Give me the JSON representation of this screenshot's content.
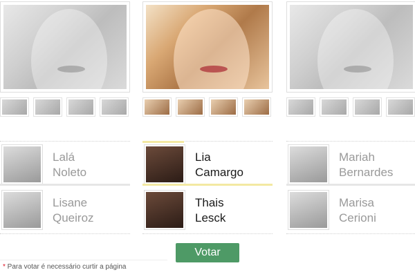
{
  "columns": [
    {
      "candidates": [
        {
          "line1": "Lalá",
          "line2": "Noleto"
        },
        {
          "line1": "Lisane",
          "line2": "Queiroz"
        }
      ]
    },
    {
      "candidates": [
        {
          "line1": "Lia",
          "line2": "Camargo"
        },
        {
          "line1": "Thais",
          "line2": "Lesck"
        }
      ]
    },
    {
      "candidates": [
        {
          "line1": "Mariah",
          "line2": "Bernardes"
        },
        {
          "line1": "Marisa",
          "line2": "Cerioni"
        }
      ]
    }
  ],
  "vote_button": {
    "label": "Votar"
  },
  "note": {
    "star": "*",
    "text": " Para votar é necessário curtir a página"
  },
  "colors": {
    "accent": "#4e9a66",
    "highlight": "#f3e9a2",
    "note_star": "#d11122"
  }
}
